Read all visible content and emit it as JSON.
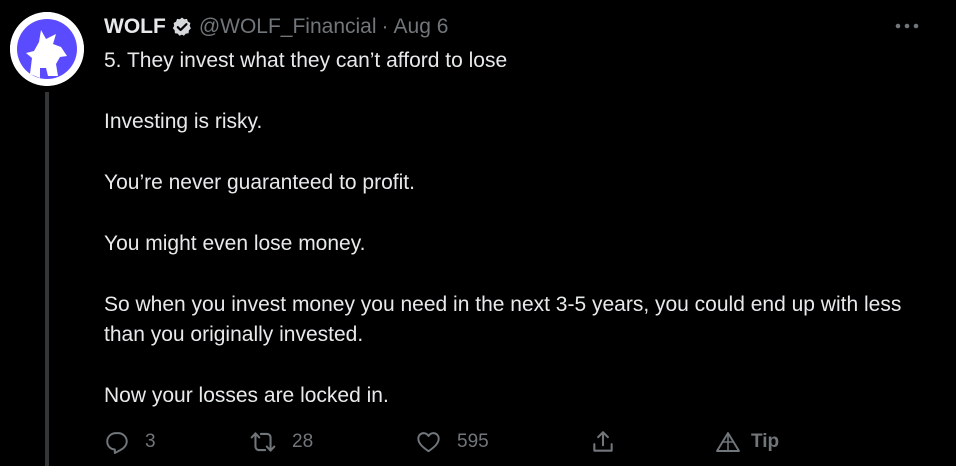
{
  "tweet": {
    "author": {
      "name": "WOLF",
      "handle": "@WOLF_Financial",
      "verified": true
    },
    "separator": "·",
    "date": "Aug 6",
    "paragraphs": [
      "5. They invest what they can’t afford to lose",
      "Investing is risky.",
      "You’re never guaranteed to profit.",
      "You might even lose money.",
      "So when you invest money you need in the next 3-5 years, you could end up with less than you originally invested.",
      "Now your losses are locked in."
    ],
    "actions": {
      "reply_count": "3",
      "retweet_count": "28",
      "like_count": "595",
      "tip_label": "Tip"
    }
  },
  "icons": {
    "avatar": "wolf-howling-logo",
    "verified": "verified-badge-icon",
    "more": "more-dots-icon",
    "reply": "reply-icon",
    "retweet": "retweet-icon",
    "like": "heart-icon",
    "share": "share-icon",
    "tip": "tip-icon"
  },
  "colors": {
    "background": "#000000",
    "text": "#e7e9ea",
    "secondary": "#71767b",
    "brand": "#5b4bff",
    "thread_line": "#333639"
  }
}
